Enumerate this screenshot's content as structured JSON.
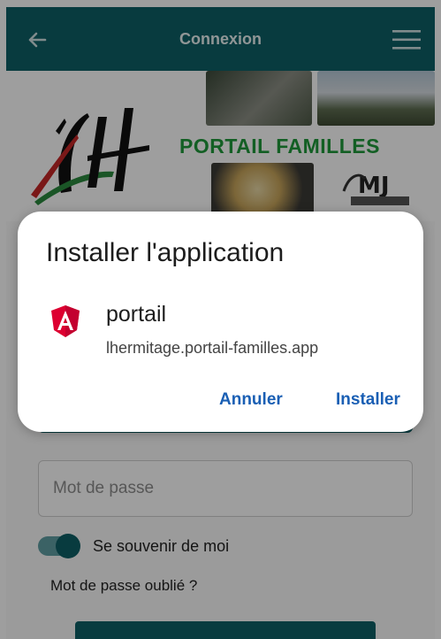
{
  "appbar": {
    "title": "Connexion",
    "back_icon": "arrow-left-icon",
    "menu_icon": "hamburger-menu-icon",
    "color": "#0d5f66"
  },
  "banner": {
    "label": "PORTAIL FAMILLES",
    "label_color": "#1f9a3a"
  },
  "form": {
    "password_placeholder": "Mot de passe",
    "remember_label": "Se souvenir de moi",
    "remember_checked": true,
    "forgot_label": "Mot de passe oublié ?"
  },
  "dialog": {
    "title": "Installer l'application",
    "app_name": "portail",
    "app_url": "lhermitage.portail-familles.app",
    "app_icon": "angular-icon",
    "cancel_label": "Annuler",
    "install_label": "Installer",
    "button_color": "#1a5fb4"
  }
}
